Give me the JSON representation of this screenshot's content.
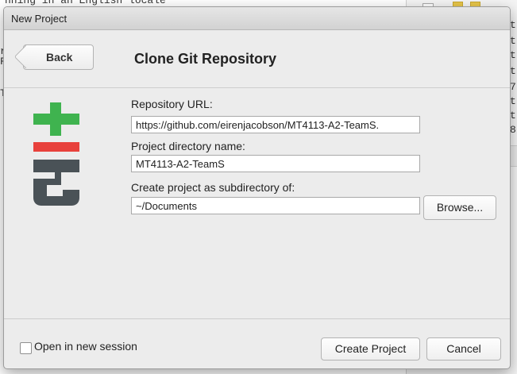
{
  "background": {
    "editor_line": "nning in an English locale",
    "left_marks": [
      "r",
      "F",
      "T"
    ],
    "right_panel_rows": [
      "t",
      "t",
      "t",
      "t",
      "7",
      "t",
      "t",
      "8"
    ]
  },
  "dialog": {
    "window_title": "New Project",
    "back_label": "Back",
    "page_title": "Clone Git Repository",
    "repo_url_label": "Repository URL:",
    "repo_url_value": "https://github.com/eirenjacobson/MT4113-A2-TeamS.",
    "dir_name_label": "Project directory name:",
    "dir_name_value": "MT4113-A2-TeamS",
    "subdir_label": "Create project as subdirectory of:",
    "subdir_value": "~/Documents",
    "browse_label": "Browse...",
    "open_new_session_label": "Open in new session",
    "open_new_session_checked": false,
    "create_label": "Create Project",
    "cancel_label": "Cancel"
  },
  "logo": {
    "name": "git-logo",
    "green": "#3fb34f",
    "red": "#e8413c",
    "gray": "#4a5257"
  }
}
